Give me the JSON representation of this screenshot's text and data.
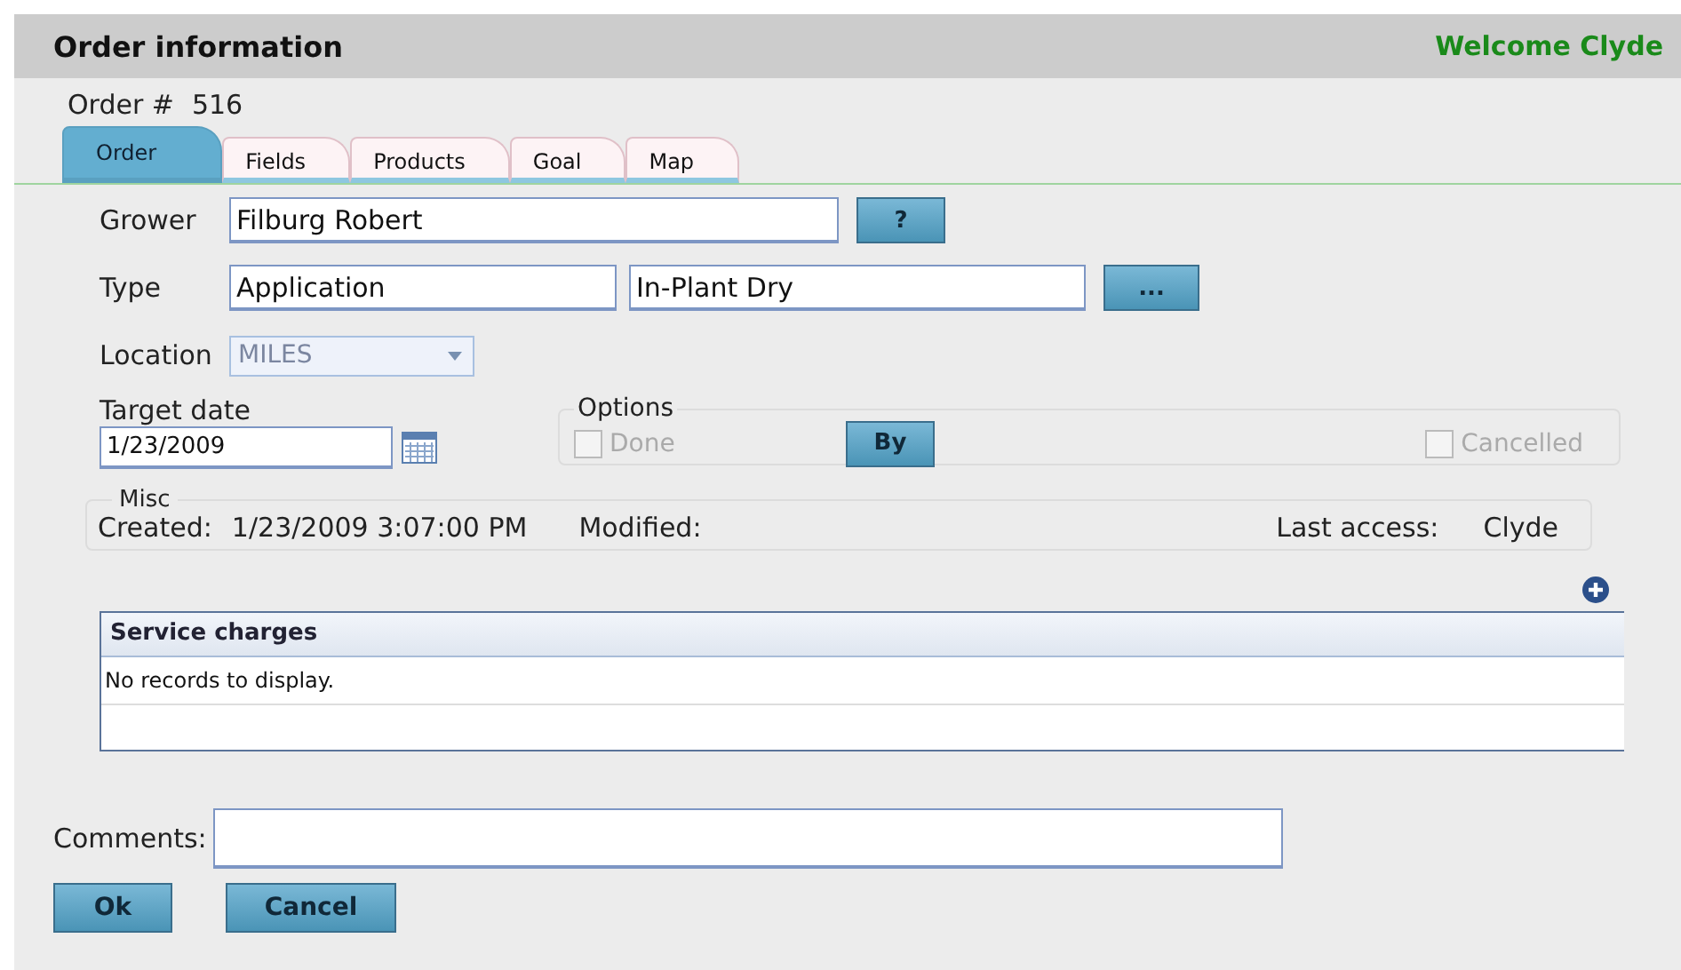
{
  "header": {
    "title": "Order information",
    "welcome": "Welcome Clyde"
  },
  "order_number": {
    "label": "Order #",
    "value": "516"
  },
  "tabs": [
    {
      "label": "Order",
      "selected": true
    },
    {
      "label": "Fields",
      "selected": false
    },
    {
      "label": "Products",
      "selected": false
    },
    {
      "label": "Goal",
      "selected": false
    },
    {
      "label": "Map",
      "selected": false
    }
  ],
  "grower": {
    "label": "Grower",
    "value": "Filburg Robert",
    "button": "?"
  },
  "type": {
    "label": "Type",
    "value": "Application",
    "subtype": "In-Plant Dry",
    "button": "..."
  },
  "location": {
    "label": "Location",
    "value": "MILES",
    "disabled": true
  },
  "target_date": {
    "label": "Target date",
    "value": "1/23/2009"
  },
  "options": {
    "legend": "Options",
    "done": {
      "label": "Done",
      "checked": false,
      "disabled": true
    },
    "by_button": "By",
    "cancelled": {
      "label": "Cancelled",
      "checked": false,
      "disabled": true
    }
  },
  "misc": {
    "legend": "Misc",
    "created_label": "Created:",
    "created": "1/23/2009 3:07:00 PM",
    "modified_label": "Modified:",
    "last_access_label": "Last access:",
    "last_access": "Clyde"
  },
  "service_charges": {
    "title": "Service charges",
    "empty": "No records to display."
  },
  "comments": {
    "label": "Comments:"
  },
  "buttons": [
    "Ok",
    "Cancel"
  ]
}
